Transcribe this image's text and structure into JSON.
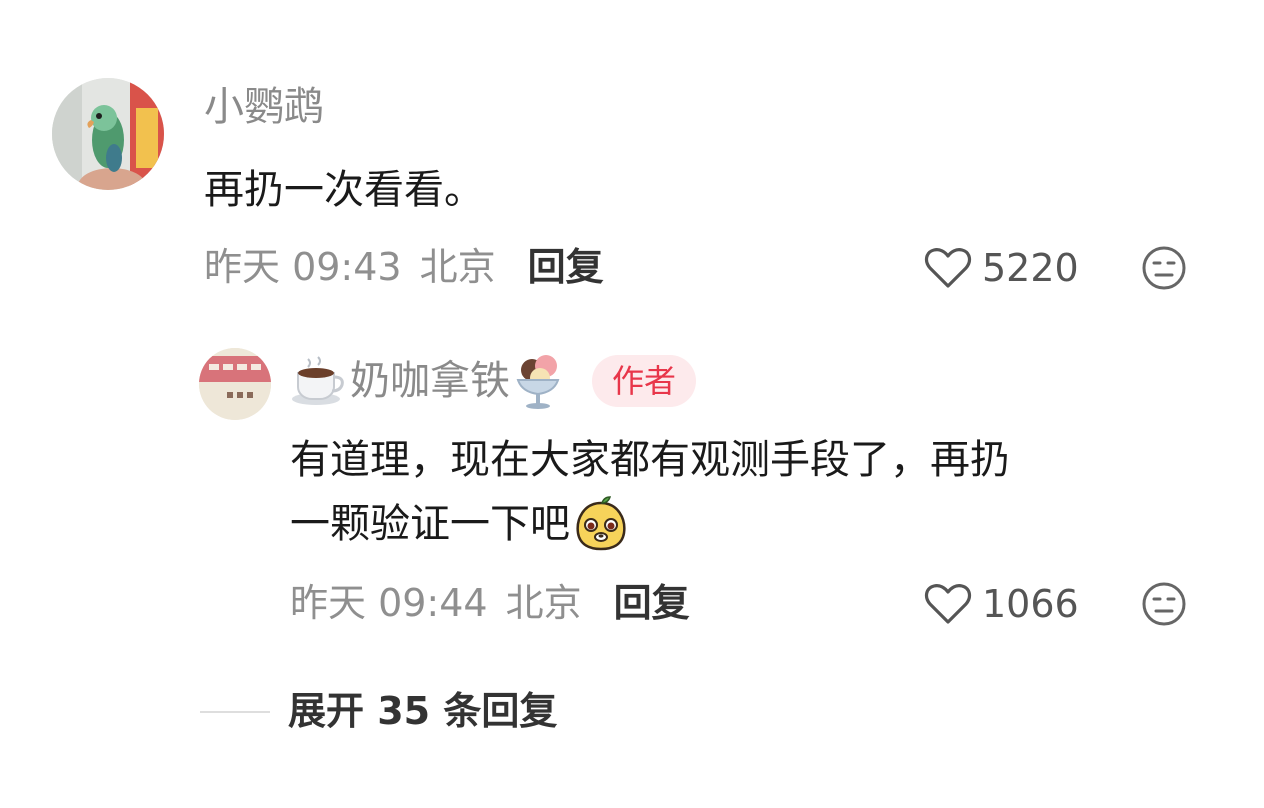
{
  "comment": {
    "username": "小鹦鹉",
    "text": "再扔一次看看。",
    "timestamp": "昨天 09:43",
    "location": "北京",
    "reply_label": "回复",
    "likes": "5220",
    "avatar_icon": "parrot-avatar-icon",
    "like_icon": "heart-outline-icon",
    "react_icon": "neutral-face-icon"
  },
  "reply": {
    "username": "奶咖拿铁",
    "username_prefix_icon": "coffee-cup-icon",
    "username_suffix_icon": "ice-cream-icon",
    "author_badge": "作者",
    "text_line1": "有道理，现在大家都有观测手段了，再扔",
    "text_line2": "一颗验证一下吧",
    "text_emoji_icon": "mango-sticker-icon",
    "timestamp": "昨天 09:44",
    "location": "北京",
    "reply_label": "回复",
    "likes": "1066",
    "like_icon": "heart-outline-icon",
    "react_icon": "neutral-face-icon"
  },
  "expand": {
    "label": "展开 35 条回复"
  },
  "colors": {
    "muted_text": "#8f8f8f",
    "badge_bg": "#fdeaec",
    "badge_text": "#e8364a"
  }
}
